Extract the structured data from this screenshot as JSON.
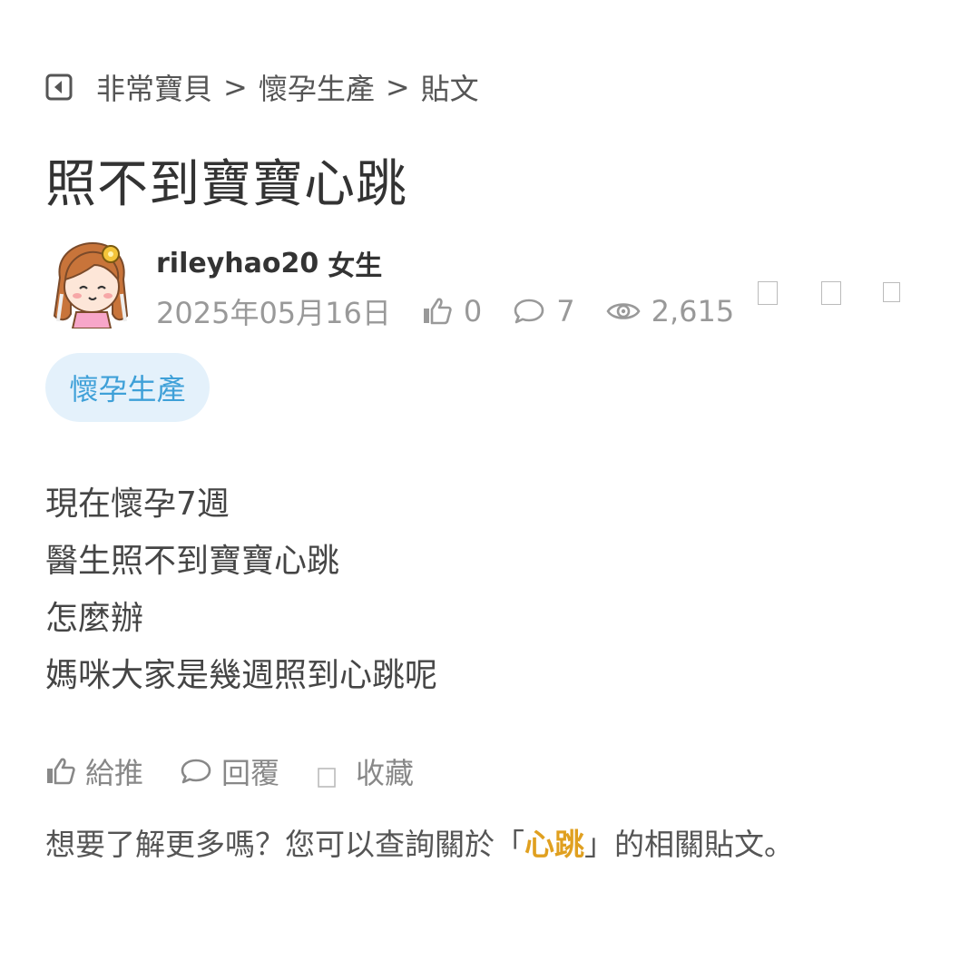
{
  "breadcrumb": {
    "items": [
      "非常寶貝",
      "懷孕生產",
      "貼文"
    ],
    "separator": ">"
  },
  "post": {
    "title": "照不到寶寶心跳",
    "author": {
      "name": "rileyhao20",
      "gender": "女生"
    },
    "date": "2025年05月16日",
    "likes": "0",
    "comments": "7",
    "views": "2,615",
    "tag": "懷孕生產",
    "content_lines": [
      "現在懷孕7週",
      "醫生照不到寶寶心跳",
      "怎麼辦",
      "媽咪大家是幾週照到心跳呢"
    ]
  },
  "actions": {
    "like_label": "給推",
    "reply_label": "回覆",
    "save_label": "收藏"
  },
  "related": {
    "prefix": "想要了解更多嗎？您可以查詢關於「",
    "keyword": "心跳",
    "suffix": "」的相關貼文。"
  },
  "colors": {
    "tag_background": "#e4f1fb",
    "tag_text": "#3ea0d8",
    "keyword": "#e0a020",
    "meta_text": "#999999"
  },
  "icons": {
    "back": "back-icon",
    "like": "thumbs-up-icon",
    "comment": "comment-bubble-icon",
    "views": "eye-icon",
    "save": "bookmark-icon"
  }
}
